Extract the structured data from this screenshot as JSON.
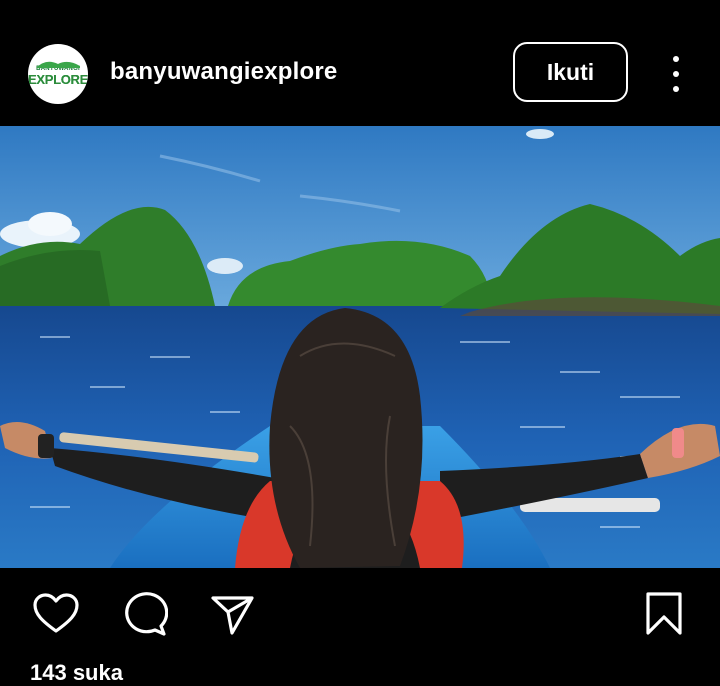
{
  "post": {
    "username": "banyuwangiexplore",
    "avatar": {
      "brand_top": "BANYUWANGI",
      "brand_main": "EXPLORE"
    },
    "follow_label": "Ikuti",
    "more_icon": "more-vertical-icon",
    "photo": {
      "description_icon": "photo"
    },
    "actions": {
      "like_icon": "heart-icon",
      "comment_icon": "comment-icon",
      "share_icon": "send-icon",
      "save_icon": "bookmark-icon"
    },
    "likes_text": "143 suka"
  },
  "colors": {
    "background": "#000000",
    "text": "#ffffff",
    "sea": "#1e5fb0",
    "sky": "#3b86cc",
    "hills": "#2f7d2a"
  }
}
